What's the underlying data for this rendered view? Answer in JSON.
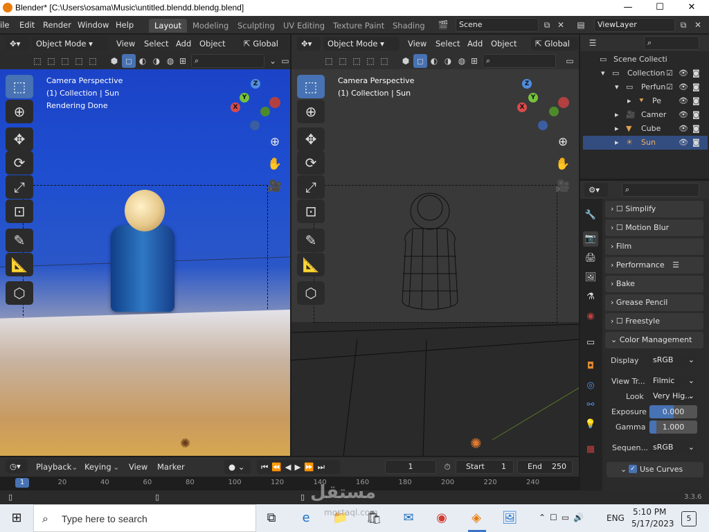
{
  "window": {
    "title": "Blender* [C:\\Users\\osama\\Music\\untitled.blendd.blendg.blend]",
    "min_label": "—",
    "max_label": "☐",
    "close_label": "✕"
  },
  "menubar": {
    "items": [
      "ile",
      "Edit",
      "Render",
      "Window",
      "Help"
    ],
    "workspaces": [
      "Layout",
      "Modeling",
      "Sculpting",
      "UV Editing",
      "Texture Paint",
      "Shading"
    ],
    "active_workspace": "Layout",
    "scene": "Scene",
    "view_layer": "ViewLayer"
  },
  "viewport_left": {
    "mode": "Object Mode",
    "menus": [
      "View",
      "Select",
      "Add",
      "Object"
    ],
    "orientation": "Global",
    "overlay": [
      "Camera Perspective",
      "(1) Collection | Sun",
      "Rendering Done"
    ]
  },
  "viewport_right": {
    "mode": "Object Mode",
    "menus": [
      "View",
      "Select",
      "Add",
      "Object"
    ],
    "orientation": "Global",
    "overlay": [
      "Camera Perspective",
      "(1) Collection | Sun"
    ]
  },
  "gizmo": {
    "x": "X",
    "y": "Y",
    "z": "Z"
  },
  "outliner": {
    "root": "Scene Collecti",
    "collection": "Collection",
    "rows": [
      {
        "label": "Perfun",
        "icon": "mesh-icon"
      },
      {
        "label": "Pe",
        "icon": "mesh-data-icon"
      },
      {
        "label": "Camer",
        "icon": "camera-icon"
      },
      {
        "label": "Cube",
        "icon": "mesh-icon"
      },
      {
        "label": "Sun",
        "icon": "light-icon"
      }
    ],
    "selected": "Sun"
  },
  "properties": {
    "panels": [
      "Simplify",
      "Motion Blur",
      "Film",
      "Performance",
      "Bake",
      "Grease Pencil",
      "Freestyle",
      "Color Management"
    ],
    "display_label": "Display",
    "display_value": "sRGB",
    "view_transform_label": "View Tr...",
    "view_transform_value": "Filmic",
    "look_label": "Look",
    "look_value": "Very Hig...",
    "exposure_label": "Exposure",
    "exposure_value": "0.000",
    "gamma_label": "Gamma",
    "gamma_value": "1.000",
    "sequencer_label": "Sequen...",
    "sequencer_value": "sRGB",
    "use_curves_label": "Use Curves",
    "use_curves_checked": true
  },
  "timeline": {
    "menus": [
      "Playback",
      "Keying",
      "View",
      "Marker"
    ],
    "current_frame": "1",
    "start_label": "Start",
    "start_value": "1",
    "end_label": "End",
    "end_value": "250",
    "ruler": [
      "0",
      "20",
      "40",
      "60",
      "80",
      "100",
      "120",
      "140",
      "160",
      "180",
      "200",
      "220",
      "240"
    ],
    "playhead": "1"
  },
  "statusbar": {
    "version": "3.3.6"
  },
  "taskbar": {
    "search_placeholder": "Type here to search",
    "time": "5:10 PM",
    "date": "5/17/2023",
    "language": "ENG",
    "notifications": "5"
  },
  "watermark": {
    "text": "مستقل",
    "sub": "mostaql.com"
  }
}
